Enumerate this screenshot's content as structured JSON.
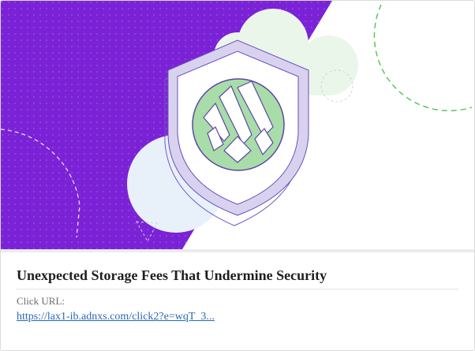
{
  "card": {
    "title": "Unexpected Storage Fees That Undermine Security",
    "click_label": "Click URL:",
    "click_url": "https://lax1-ib.adnxs.com/click2?e=wqT_3..."
  },
  "hero": {
    "icon": "shield-icon",
    "badge_icon": "wasabi-logo-icon",
    "colors": {
      "purple": "#7b22d6",
      "lavender": "#d9d2ef",
      "green": "#a8dca8",
      "mint": "#eaf6ea",
      "pale_blue": "#e8f0f9"
    }
  }
}
